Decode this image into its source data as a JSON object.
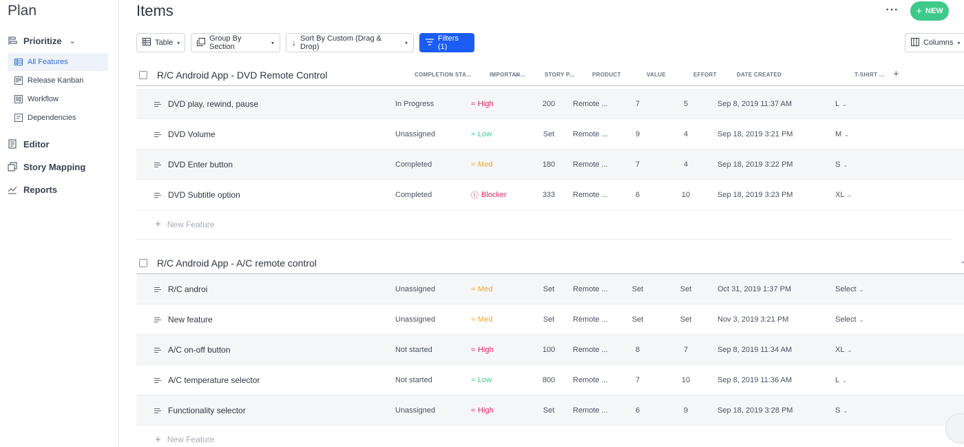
{
  "sidebar": {
    "title": "Plan",
    "prioritize_label": "Prioritize",
    "sub_items": [
      {
        "label": "All Features",
        "active": true
      },
      {
        "label": "Release Kanban"
      },
      {
        "label": "Workflow"
      },
      {
        "label": "Dependencies"
      }
    ],
    "items": [
      {
        "label": "Editor"
      },
      {
        "label": "Story Mapping"
      },
      {
        "label": "Reports"
      }
    ]
  },
  "header": {
    "title": "Items",
    "more_label": "···",
    "new_label": "NEW"
  },
  "toolbar": {
    "table_label": "Table",
    "group_label": "Group By Section",
    "sort_label": "Sort By Custom (Drag & Drop)",
    "filters_label": "Filters (1)",
    "columns_label": "Columns"
  },
  "columns": [
    "COMPLETION STA...",
    "IMPORTAN...",
    "STORY P...",
    "PRODUCT",
    "VALUE",
    "EFFORT",
    "DATE CREATED",
    "T-SHIRT ..."
  ],
  "sections": [
    {
      "title": "R/C Android App - DVD Remote Control",
      "rows": [
        {
          "name": "DVD play, rewind, pause",
          "status": "In Progress",
          "importance": "High",
          "imp_sym": "≈",
          "story": "200",
          "product": "Remote ...",
          "value": "7",
          "effort": "5",
          "date": "Sep 8, 2019 11:37 AM",
          "tshirt": "L"
        },
        {
          "name": "DVD Volume",
          "status": "Unassigned",
          "importance": "Low",
          "imp_sym": "≈",
          "story": "Set",
          "product": "Remote ...",
          "value": "9",
          "effort": "4",
          "date": "Sep 18, 2019 3:21 PM",
          "tshirt": "M"
        },
        {
          "name": "DVD Enter button",
          "status": "Completed",
          "importance": "Med",
          "imp_sym": "≈",
          "story": "180",
          "product": "Remote ...",
          "value": "7",
          "effort": "4",
          "date": "Sep 18, 2019 3:22 PM",
          "tshirt": "S"
        },
        {
          "name": "DVD Subtitle option",
          "status": "Completed",
          "importance": "Blocker",
          "imp_sym": "ⓘ",
          "story": "333",
          "product": "Remote ...",
          "value": "6",
          "effort": "10",
          "date": "Sep 18, 2019 3:23 PM",
          "tshirt": "XL"
        }
      ],
      "new_label": "New Feature"
    },
    {
      "title": "R/C Android App - A/C remote control",
      "rows": [
        {
          "name": "R/C androi",
          "status": "Unassigned",
          "importance": "Med",
          "imp_sym": "≈",
          "story": "Set",
          "product": "Remote ...",
          "value": "Set",
          "effort": "Set",
          "date": "Oct 31, 2019 1:37 PM",
          "tshirt": "Select"
        },
        {
          "name": "New feature",
          "status": "Unassigned",
          "importance": "Med",
          "imp_sym": "≈",
          "story": "Set",
          "product": "Remote ...",
          "value": "Set",
          "effort": "Set",
          "date": "Nov 3, 2019 3:21 PM",
          "tshirt": "Select"
        },
        {
          "name": "A/C on-off button",
          "status": "Not started",
          "importance": "High",
          "imp_sym": "≈",
          "story": "100",
          "product": "Remote ...",
          "value": "8",
          "effort": "7",
          "date": "Sep 8, 2019 11:34 AM",
          "tshirt": "XL"
        },
        {
          "name": "A/C temperature selector",
          "status": "Not started",
          "importance": "Low",
          "imp_sym": "≈",
          "story": "800",
          "product": "Remote ...",
          "value": "7",
          "effort": "10",
          "date": "Sep 8, 2019 11:36 AM",
          "tshirt": "L"
        },
        {
          "name": "Functionality selector",
          "status": "Unassigned",
          "importance": "High",
          "imp_sym": "≈",
          "story": "Set",
          "product": "Remote ...",
          "value": "6",
          "effort": "9",
          "date": "Sep 18, 2019 3:28 PM",
          "tshirt": "S"
        }
      ],
      "new_label": "New Feature"
    }
  ],
  "colors": {
    "High": "#e0245e",
    "Blocker": "#e0245e",
    "Med": "#f5a623",
    "Low": "#3dc98a",
    "accent": "#1b5cf5",
    "new_button": "#3dc98a"
  },
  "icons": {
    "table": "table-icon",
    "group": "group-icon",
    "sort": "sort-arrow-icon",
    "filter": "filter-icon",
    "columns": "columns-icon",
    "drag": "drag-handle-icon",
    "add": "plus-icon",
    "chat": "chat-icon"
  }
}
